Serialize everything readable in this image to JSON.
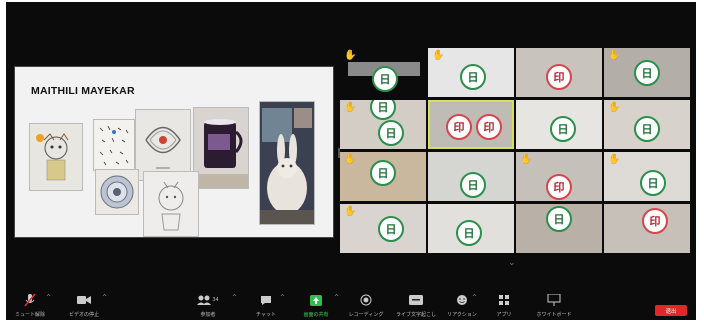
{
  "share": {
    "title": "MAITHILI MAYEKAR"
  },
  "grid": {
    "mark_green": "日",
    "mark_red": "印"
  },
  "toolbar": {
    "mute": "ミュート解除",
    "video": "ビデオの停止",
    "participants": "参加者",
    "participants_count": "34",
    "chat": "チャット",
    "share": "画面の共有",
    "record": "レコーディング",
    "captions": "ライブ文字起こし",
    "reactions": "リアクション",
    "apps": "アプリ",
    "whiteboard": "ホワイトボード",
    "leave": "退出"
  },
  "colors": {
    "accent_green": "#2a8f4b",
    "accent_red": "#d6454b",
    "leave_red": "#e02828",
    "share_green": "#2fbf4f"
  }
}
